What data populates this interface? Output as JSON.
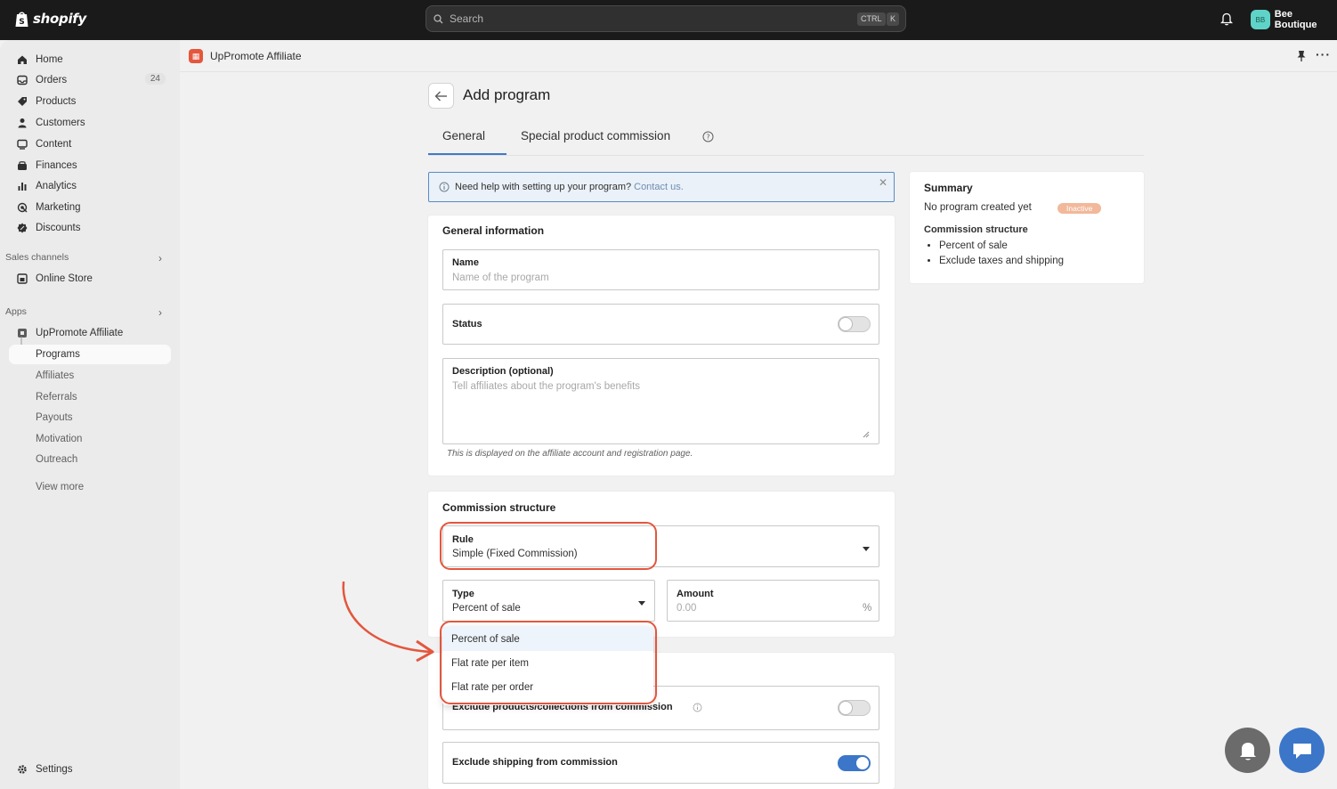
{
  "topbar": {
    "brand": "shopify",
    "search_placeholder": "Search",
    "shortcut_ctrl": "CTRL",
    "shortcut_k": "K",
    "store_initials": "BB",
    "store_name": "Bee Boutique"
  },
  "sidebar": {
    "items": [
      {
        "label": "Home",
        "icon": "home-icon"
      },
      {
        "label": "Orders",
        "icon": "orders-icon",
        "count": "24"
      },
      {
        "label": "Products",
        "icon": "tag-icon"
      },
      {
        "label": "Customers",
        "icon": "person-icon"
      },
      {
        "label": "Content",
        "icon": "content-icon"
      },
      {
        "label": "Finances",
        "icon": "finance-icon"
      },
      {
        "label": "Analytics",
        "icon": "bar-chart-icon"
      },
      {
        "label": "Marketing",
        "icon": "target-icon"
      },
      {
        "label": "Discounts",
        "icon": "discount-icon"
      }
    ],
    "sales_channels_title": "Sales channels",
    "online_store": "Online Store",
    "apps_title": "Apps",
    "app_name": "UpPromote Affiliate",
    "app_sub_items": [
      "Programs",
      "Affiliates",
      "Referrals",
      "Payouts",
      "Motivation",
      "Outreach"
    ],
    "view_more": "View more",
    "settings": "Settings"
  },
  "app_header": {
    "title": "UpPromote Affiliate"
  },
  "page": {
    "title": "Add program",
    "tabs": [
      "General",
      "Special product commission"
    ],
    "info_text": "Need help with setting up your program?",
    "info_link": "Contact us.",
    "general_info_title": "General information",
    "name_label": "Name",
    "name_placeholder": "Name of the program",
    "status_label": "Status",
    "description_label": "Description (optional)",
    "description_placeholder": "Tell affiliates about the program's benefits",
    "description_hint": "This is displayed on the affiliate account and registration page.",
    "commission_title": "Commission structure",
    "rule_label": "Rule",
    "rule_value": "Simple (Fixed Commission)",
    "type_label": "Type",
    "type_value": "Percent of sale",
    "amount_label": "Amount",
    "amount_placeholder": "0.00",
    "amount_unit": "%",
    "type_options": [
      "Percent of sale",
      "Flat rate per item",
      "Flat rate per order"
    ],
    "exclude_products_label": "Exclude products/collections from commission",
    "exclude_shipping_label": "Exclude shipping from commission",
    "status_on": false,
    "exclude_products_on": false,
    "exclude_shipping_on": true
  },
  "summary": {
    "title": "Summary",
    "no_program": "No program created yet",
    "badge": "Inactive",
    "commission_title": "Commission structure",
    "bullets": [
      "Percent of sale",
      "Exclude taxes and shipping"
    ]
  },
  "colors": {
    "annotation_red": "#e3563e",
    "accent_blue": "#3b76c9",
    "topbar": "#1a1a1a"
  }
}
